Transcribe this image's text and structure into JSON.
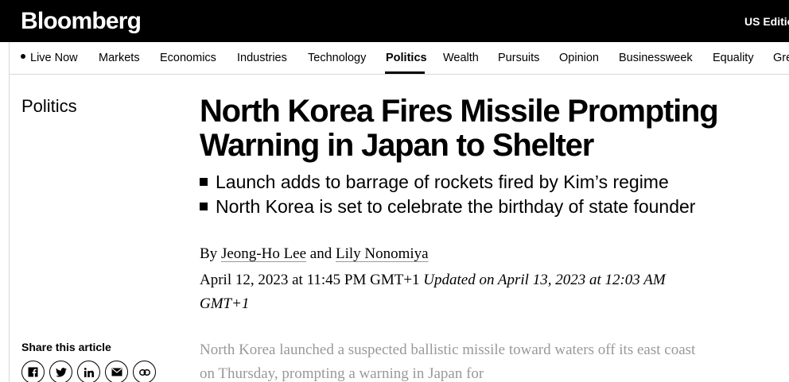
{
  "header": {
    "logo": "Bloomberg",
    "edition": "US Edition"
  },
  "nav": {
    "items": [
      {
        "label": "Live Now",
        "live": true
      },
      {
        "label": "Markets"
      },
      {
        "label": "Economics"
      },
      {
        "label": "Industries"
      },
      {
        "label": "Technology"
      },
      {
        "label": "Politics",
        "active": true
      },
      {
        "label": "Wealth"
      },
      {
        "label": "Pursuits"
      },
      {
        "label": "Opinion"
      },
      {
        "label": "Businessweek"
      },
      {
        "label": "Equality"
      },
      {
        "label": "Green"
      }
    ]
  },
  "article": {
    "section": "Politics",
    "headline": "North Korea Fires Missile Prompting Warning in Japan to Shelter",
    "bullets": [
      "Launch adds to barrage of rockets fired by Kim’s regime",
      "North Korea is set to celebrate the birthday of state founder"
    ],
    "byline": {
      "prefix": "By",
      "author1": "Jeong-Ho Lee",
      "conjunction": "and",
      "author2": "Lily Nonomiya"
    },
    "published": "April 12, 2023 at 11:45 PM GMT+1",
    "updated": "Updated on April 13, 2023 at 12:03 AM GMT+1",
    "body": "North Korea launched a suspected ballistic missile toward waters off its east coast on Thursday, prompting a warning in Japan for"
  },
  "share": {
    "label": "Share this article",
    "buttons": [
      "facebook-icon",
      "twitter-icon",
      "linkedin-icon",
      "email-icon",
      "link-icon"
    ]
  }
}
